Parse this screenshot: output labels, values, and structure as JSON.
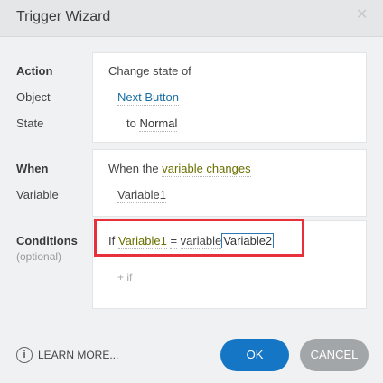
{
  "dialog": {
    "title": "Trigger Wizard",
    "close_glyph": "✕"
  },
  "labels": {
    "action": "Action",
    "object": "Object",
    "state": "State",
    "when": "When",
    "variable": "Variable",
    "conditions": "Conditions",
    "optional": "(optional)"
  },
  "values": {
    "action": "Change state of",
    "object": "Next Button",
    "state_prefix": "to",
    "state": "Normal",
    "when_prefix": "When the",
    "when": "variable changes",
    "variable": "Variable1",
    "cond_if": "If",
    "cond_var1": "Variable1",
    "cond_op": "=",
    "cond_type": "variable",
    "cond_var2": "Variable2",
    "add_if": "+ if"
  },
  "footer": {
    "learn_more": "LEARN MORE...",
    "info_glyph": "i",
    "ok": "OK",
    "cancel": "CANCEL"
  },
  "colors": {
    "primary": "#1576c6",
    "highlight": "#e8303a",
    "secondary_button": "#a3a6a9"
  }
}
